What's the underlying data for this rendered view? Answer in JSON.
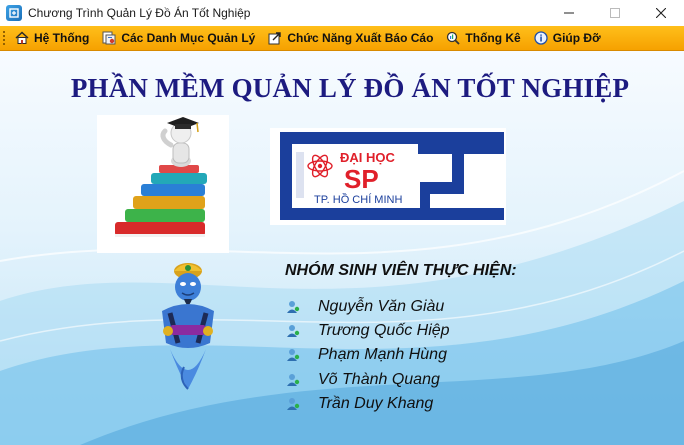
{
  "window": {
    "title": "Chương Trình Quản Lý Đồ Án Tốt Nghiệp",
    "icon": "app-window-icon"
  },
  "menu": [
    {
      "label": "Hệ Thống",
      "icon": "home-icon"
    },
    {
      "label": "Các Danh Mục Quản Lý",
      "icon": "categories-icon"
    },
    {
      "label": "Chức Năng Xuất Báo Cáo",
      "icon": "export-report-icon"
    },
    {
      "label": "Thống Kê",
      "icon": "statistics-icon"
    },
    {
      "label": "Giúp Đỡ",
      "icon": "help-icon"
    }
  ],
  "main": {
    "heading": "PHẦN MỀM QUẢN LÝ ĐỒ ÁN TỐT NGHIỆP",
    "logo": {
      "line1": "ĐẠI HỌC",
      "line2": "SP",
      "line3": "TP. HỒ CHÍ MINH"
    },
    "team_heading": "NHÓM SINH VIÊN THỰC HIỆN:",
    "members": [
      "Nguyễn Văn Giàu",
      "Trương Quốc Hiệp",
      "Phạm Mạnh Hùng",
      "Võ Thành Quang",
      "Trần Duy Khang"
    ]
  },
  "colors": {
    "menubar": "#f6a100",
    "heading": "#1d1b80",
    "logo_blue": "#1b3f9c",
    "logo_red": "#e0202a"
  }
}
